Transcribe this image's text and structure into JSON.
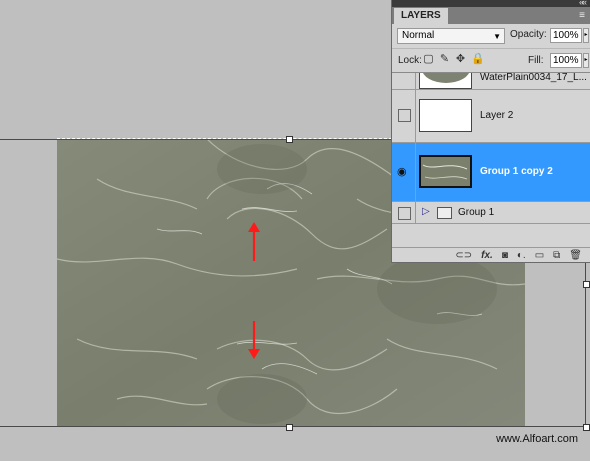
{
  "panel": {
    "tab_label": "LAYERS",
    "collapse_glyph": "««",
    "menu_glyph": "≡",
    "blend_mode": "Normal",
    "opacity_label": "Opacity:",
    "opacity_value": "100%",
    "lock_label": "Lock:",
    "fill_label": "Fill:",
    "fill_value": "100%",
    "lock_icon_glyphs": [
      "▢",
      "✎",
      "✥",
      "🔒"
    ],
    "layers": [
      {
        "name": "WaterPlain0034_17_L...",
        "visible": false,
        "selected": false,
        "thumb": "water"
      },
      {
        "name": "Layer 2",
        "visible": false,
        "selected": false,
        "thumb": "white"
      },
      {
        "name": "Group 1 copy 2",
        "visible": true,
        "selected": true,
        "thumb": "water"
      },
      {
        "name": "Group 1",
        "visible": false,
        "selected": false,
        "thumb": "folder"
      }
    ],
    "bottom_icons": [
      "link-icon",
      "fx-icon",
      "mask-icon",
      "adjustment-icon",
      "folder-icon",
      "new-layer-icon",
      "trash-icon"
    ]
  },
  "watermark": "www.Alfoart.com",
  "colors": {
    "selection": "#3399ff",
    "arrow": "#ff1a1a",
    "water_base": "#7d8270"
  }
}
